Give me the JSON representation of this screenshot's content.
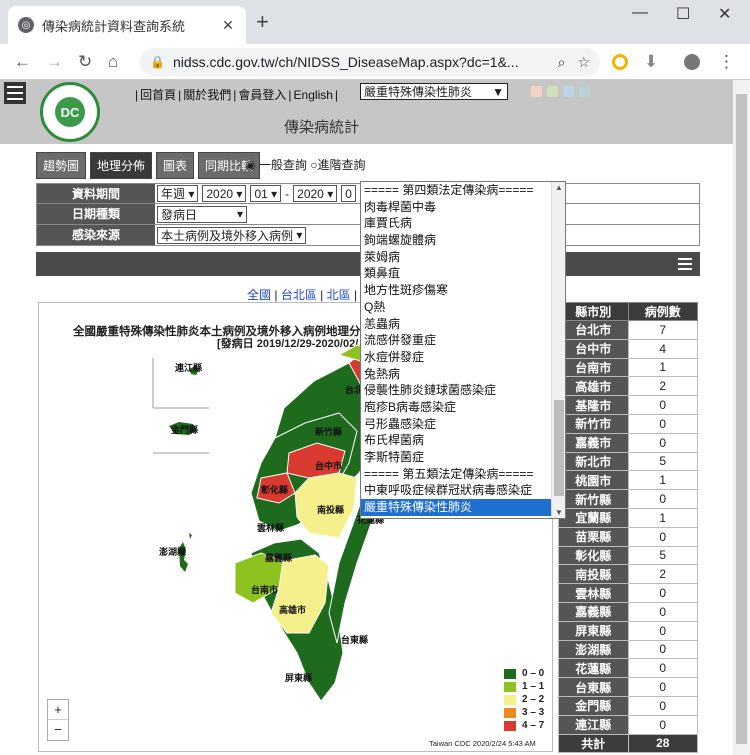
{
  "browser": {
    "tab_title": "傳染病統計資料查詢系統",
    "url": "nidss.cdc.gov.tw/ch/NIDSS_DiseaseMap.aspx?dc=1&...",
    "minimize": "—",
    "maximize": "☐",
    "close": "✕",
    "new_tab": "+"
  },
  "header": {
    "links": [
      "回首頁",
      "關於我們",
      "會員登入",
      "English"
    ],
    "disease_selected": "嚴重特殊傳染性肺炎",
    "title": "傳染病統計",
    "swatch_colors": [
      "#f3d3c4",
      "#cfe1b9",
      "#bcd5e8",
      "#b9d4d4"
    ]
  },
  "tabs": [
    "趨勢圖",
    "地理分佈",
    "圖表",
    "同期比較"
  ],
  "radios": [
    "一般查詢",
    "進階查詢"
  ],
  "form": {
    "period_label": "資料期間",
    "period_type": "年週",
    "year_from": "2020",
    "week_from": "01",
    "dash": "-",
    "year_to": "2020",
    "week_to": "0",
    "date_type_label": "日期種類",
    "date_type": "發病日",
    "source_label": "感染來源",
    "source": "本土病例及境外移入病例"
  },
  "region_links": [
    "全國",
    "台北區",
    "北區",
    "中"
  ],
  "map": {
    "title": "全國嚴重特殊傳染性肺炎本土病例及境外移入病例地理分",
    "subtitle": "[發病日 2019/12/29-2020/02/",
    "credit": "Taiwan CDC 2020/2/24 5:43 AM",
    "labels": [
      "連江縣",
      "金門縣",
      "台北市",
      "新竹縣",
      "台中市",
      "彰化縣",
      "南投縣",
      "花蓮縣",
      "雲林縣",
      "嘉義縣",
      "澎湖縣",
      "台南市",
      "高雄市",
      "台東縣",
      "屏東縣"
    ],
    "legend": [
      {
        "label": "0 – 0",
        "color": "#1e6b1e"
      },
      {
        "label": "1 – 1",
        "color": "#8dc21f"
      },
      {
        "label": "2 – 2",
        "color": "#f5f08c"
      },
      {
        "label": "3 – 3",
        "color": "#f08a1c"
      },
      {
        "label": "4 – 7",
        "color": "#d83a2f"
      }
    ],
    "zoom_in": "+",
    "zoom_out": "−"
  },
  "county_table": {
    "col_county": "縣市別",
    "col_cases": "病例數",
    "rows": [
      {
        "name": "台北市",
        "cases": "7"
      },
      {
        "name": "台中市",
        "cases": "4"
      },
      {
        "name": "台南市",
        "cases": "1"
      },
      {
        "name": "高雄市",
        "cases": "2"
      },
      {
        "name": "基隆市",
        "cases": "0"
      },
      {
        "name": "新竹市",
        "cases": "0"
      },
      {
        "name": "嘉義市",
        "cases": "0"
      },
      {
        "name": "新北市",
        "cases": "5"
      },
      {
        "name": "桃園市",
        "cases": "1"
      },
      {
        "name": "新竹縣",
        "cases": "0"
      },
      {
        "name": "宜蘭縣",
        "cases": "1"
      },
      {
        "name": "苗栗縣",
        "cases": "0"
      },
      {
        "name": "彰化縣",
        "cases": "5"
      },
      {
        "name": "南投縣",
        "cases": "2"
      },
      {
        "name": "雲林縣",
        "cases": "0"
      },
      {
        "name": "嘉義縣",
        "cases": "0"
      },
      {
        "name": "屏東縣",
        "cases": "0"
      },
      {
        "name": "澎湖縣",
        "cases": "0"
      },
      {
        "name": "花蓮縣",
        "cases": "0"
      },
      {
        "name": "台東縣",
        "cases": "0"
      },
      {
        "name": "金門縣",
        "cases": "0"
      },
      {
        "name": "連江縣",
        "cases": "0"
      }
    ],
    "total_label": "共計",
    "total": "28"
  },
  "dropdown": {
    "options": [
      "===== 第四類法定傳染病=====",
      "肉毒桿菌中毒",
      "庫賈氏病",
      "鉤端螺旋體病",
      "萊姆病",
      "類鼻疽",
      "地方性斑疹傷寒",
      "Q熱",
      "恙蟲病",
      "流感併發重症",
      "水痘併發症",
      "兔熱病",
      "侵襲性肺炎鏈球菌感染症",
      "庖疹B病毒感染症",
      "弓形蟲感染症",
      "布氏桿菌病",
      "李斯特菌症",
      "===== 第五類法定傳染病=====",
      "中東呼吸症候群冠狀病毒感染症",
      "嚴重特殊傳染性肺炎"
    ],
    "selected_index": 19
  }
}
